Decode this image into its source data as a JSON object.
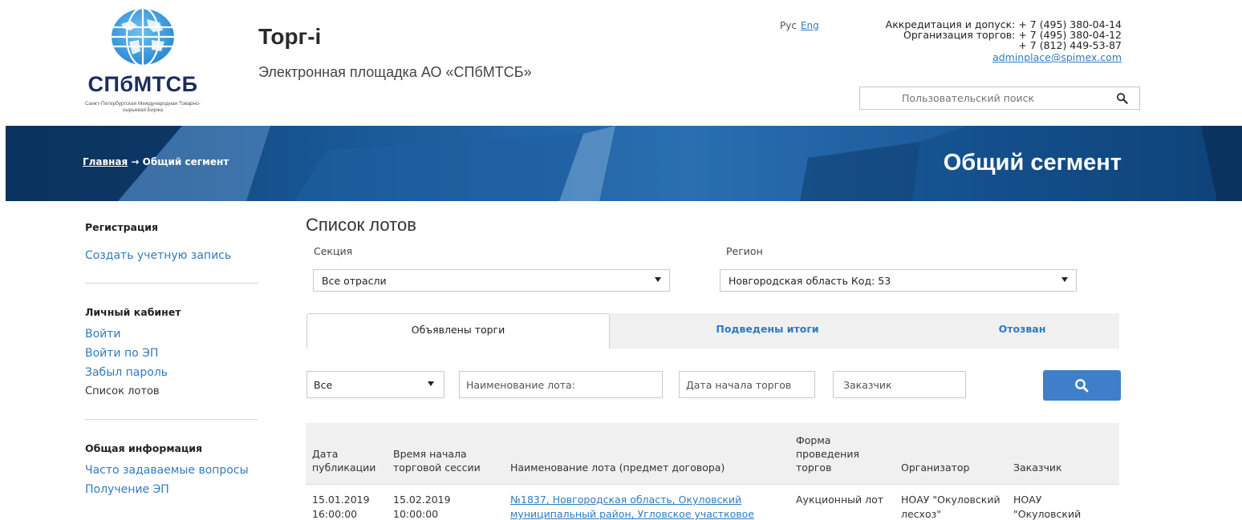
{
  "header": {
    "logo_name": "СПбМТСБ",
    "logo_sub": "Санкт-Петербургская Международная Товарно-сырьевая Биржа",
    "site_title": "Торг-i",
    "site_sub": "Электронная площадка АО «СПбМТСБ»",
    "lang_ru": "Рус",
    "lang_en": "Eng",
    "contact_1": "Аккредитация и допуск: + 7 (495) 380-04-14",
    "contact_2": "Организация торгов: + 7 (495) 380-04-12",
    "contact_3": "+ 7 (812) 449-53-87",
    "email": "adminplace@spimex.com",
    "search_placeholder": "Пользовательский поиск"
  },
  "banner": {
    "breadcrumb_home": "Главная",
    "breadcrumb_arrow": "→",
    "breadcrumb_current": "Общий сегмент",
    "title": "Общий сегмент"
  },
  "sidebar": {
    "registration_head": "Регистрация",
    "create_account": "Создать учетную запись",
    "cabinet_head": "Личный кабинет",
    "login": "Войти",
    "login_ep": "Войти по ЭП",
    "forgot": "Забыл пароль",
    "lots_list": "Список лотов",
    "info_head": "Общая информация",
    "faq": "Часто задаваемые вопросы",
    "get_ep": "Получение ЭП"
  },
  "main": {
    "title": "Список лотов",
    "section_label": "Секция",
    "section_value": "Все отрасли",
    "region_label": "Регион",
    "region_value": "Новгородская область Код: 53",
    "tabs": [
      "Объявлены торги",
      "Подведены итоги",
      "Отозван"
    ],
    "filter_type": "Все",
    "filter_name_placeholder": "Наименование лота:",
    "filter_date_placeholder": "Дата начала торгов",
    "filter_customer_placeholder": "Заказчик"
  },
  "table": {
    "headers": {
      "pub_date_1": "Дата",
      "pub_date_2": "публикации",
      "start_1": "Время начала",
      "start_2": "торговой сессии",
      "name": "Наименование лота (предмет договора)",
      "form_1": "Форма",
      "form_2": "проведения",
      "form_3": "торгов",
      "organizer": "Организатор",
      "customer": "Заказчик"
    },
    "rows": [
      {
        "pub_date": "15.01.2019",
        "pub_time": "16:00:00",
        "start_date": "15.02.2019",
        "start_time": "10:00:00",
        "name_1": "№1837, Новгородская область, Окуловский",
        "name_2": "муниципальный район, Угловское участковое",
        "form": "Аукционный лот",
        "organizer_1": "НОАУ \"Окуловский",
        "organizer_2": "лесхоз\"",
        "customer_1": "НОАУ",
        "customer_2": "\"Окуловский"
      }
    ]
  },
  "colors": {
    "accent": "#2f7bbf",
    "button": "#3f7fc9",
    "banner": "#1a5a99",
    "logo": "#1c2d5a"
  }
}
